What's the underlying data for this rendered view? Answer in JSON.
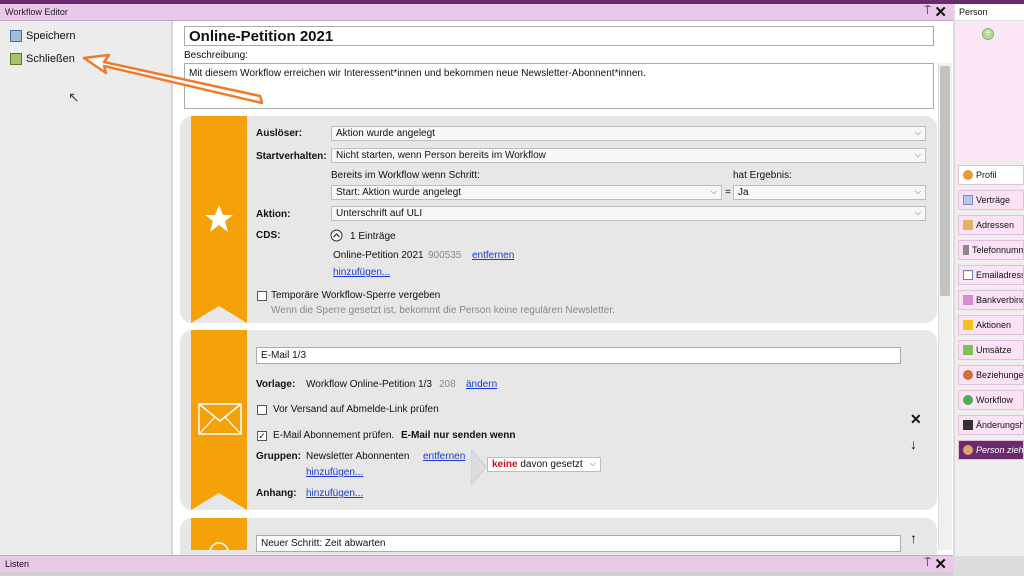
{
  "workflow_panel": {
    "title": "Workflow Editor",
    "pin": "⍑",
    "close": "✕"
  },
  "sidebar": {
    "save": "Speichern",
    "close": "Schließen"
  },
  "workflow": {
    "name": "Online-Petition 2021",
    "description_label": "Beschreibung:",
    "description": "Mit diesem Workflow erreichen wir Interessent*innen und bekommen neue Newsletter-Abonnent*innen."
  },
  "trigger_step": {
    "ausloeser_label": "Auslöser:",
    "ausloeser_value": "Aktion wurde angelegt",
    "start_label": "Startverhalten:",
    "start_value": "Nicht starten, wenn Person bereits im Workflow",
    "bereits_label": "Bereits im Workflow wenn Schritt:",
    "hat_label": "hat Ergebnis:",
    "step_value": "Start: Aktion wurde angelegt",
    "eq": "=",
    "ergebnis_value": "Ja",
    "aktion_label": "Aktion:",
    "aktion_value": "Unterschrift auf ULI",
    "cds_label": "CDS:",
    "cds_count": "1 Einträge",
    "cds_item": "Online-Petition 2021",
    "cds_item_id": "900535",
    "remove": "entfernen",
    "add": "hinzufügen...",
    "lock_label": "Temporäre Workflow-Sperre vergeben",
    "lock_hint": "Wenn die Sperre gesetzt ist, bekommt die Person keine regulären Newsletter."
  },
  "email_step": {
    "name": "E-Mail 1/3",
    "vorlage_label": "Vorlage:",
    "vorlage_value": "Workflow Online-Petition 1/3",
    "vorlage_id": "208",
    "change": "ändern",
    "check1": "Vor Versand auf Abmelde-Link prüfen",
    "check2": "E-Mail Abonnement prüfen.",
    "check2_bold": "E-Mail nur senden wenn",
    "gruppen_label": "Gruppen:",
    "gruppen_value": "Newsletter Abonnenten",
    "remove": "entfernen",
    "add": "hinzufügen...",
    "condition_keine": "keine",
    "condition_rest": "davon gesetzt",
    "anhang_label": "Anhang:",
    "anhang_add": "hinzufügen...",
    "x_symbol": "✕",
    "down_symbol": "↓"
  },
  "wait_step": {
    "name": "Neuer Schritt: Zeit abwarten",
    "up_symbol": "↑"
  },
  "person_panel": {
    "title": "Person",
    "tabs": [
      {
        "label": "Profil"
      },
      {
        "label": "Verträge"
      },
      {
        "label": "Adressen"
      },
      {
        "label": "Telefonnummern"
      },
      {
        "label": "Emailadressen"
      },
      {
        "label": "Bankverbindungen"
      },
      {
        "label": "Aktionen"
      },
      {
        "label": "Umsätze"
      },
      {
        "label": "Beziehungen"
      },
      {
        "label": "Workflow"
      },
      {
        "label": "Änderungshistorie"
      },
      {
        "label": "Person ziehen"
      }
    ]
  },
  "listen_panel": {
    "title": "Listen",
    "pin": "⍑",
    "close": "✕"
  },
  "colors": {
    "accent_orange": "#f5a20a",
    "panel_pink": "#e9c8ea",
    "link_blue": "#1a3bd6",
    "arrow": "#f07a2a"
  }
}
